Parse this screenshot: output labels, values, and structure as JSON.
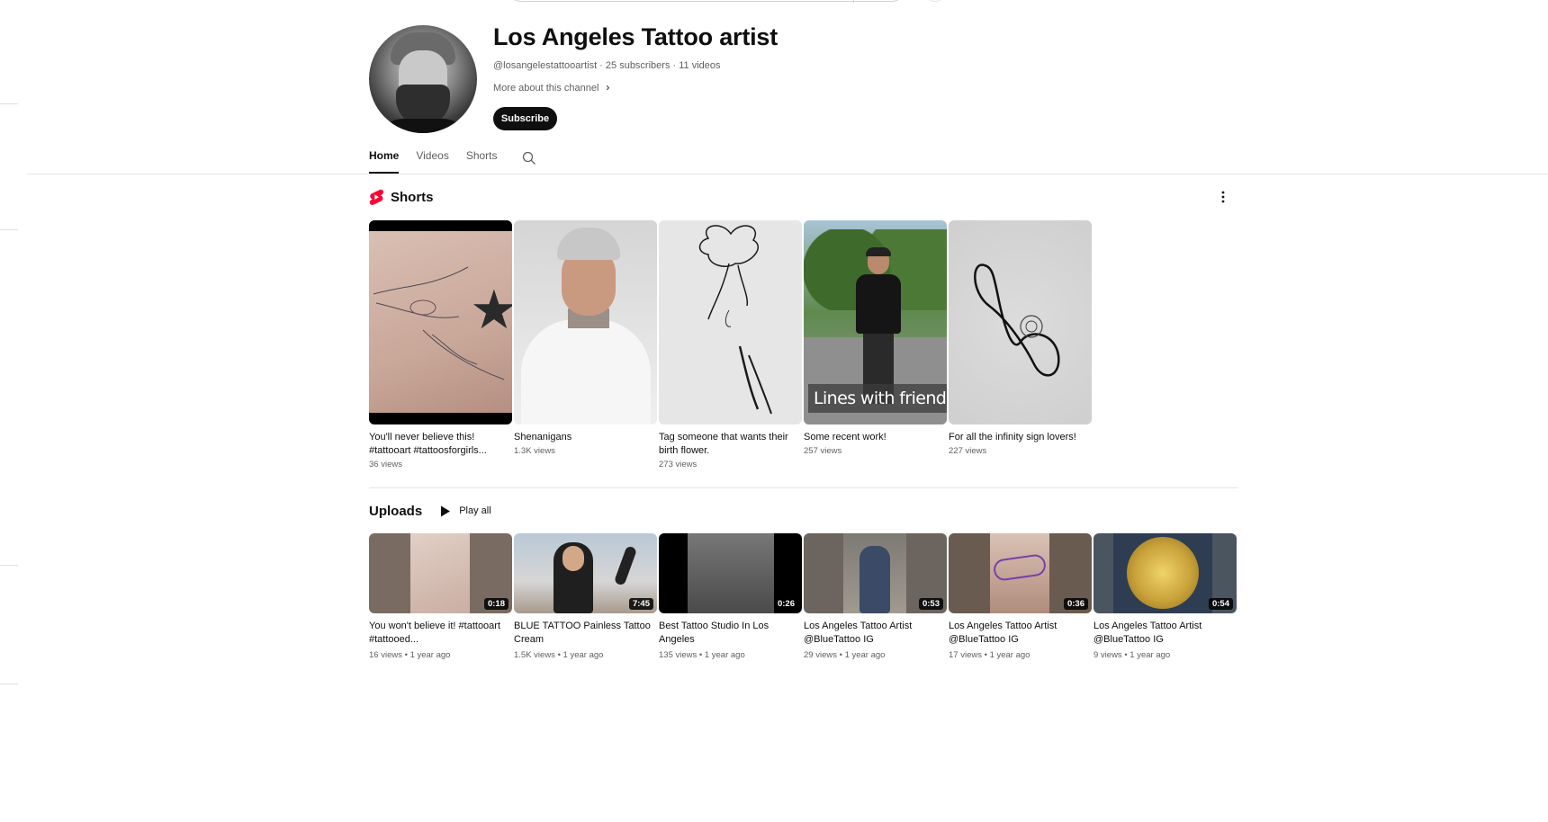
{
  "channel": {
    "title": "Los Angeles Tattoo artist",
    "handle": "@losangelestattooartist",
    "subscribers": "25 subscribers",
    "videos_count": "11 videos",
    "separator": " · ",
    "more_about": "More about this channel",
    "subscribe_label": "Subscribe"
  },
  "tabs": [
    {
      "label": "Home",
      "active": true
    },
    {
      "label": "Videos",
      "active": false
    },
    {
      "label": "Shorts",
      "active": false
    }
  ],
  "shorts": {
    "section_title": "Shorts",
    "items": [
      {
        "title": "You'll never believe this! #tattooart #tattoosforgirls...",
        "views": "36 views"
      },
      {
        "title": "Shenanigans",
        "views": "1.3K views"
      },
      {
        "title": "Tag someone that wants their birth flower.",
        "views": "273 views"
      },
      {
        "title": "Some recent work!",
        "views": "257 views",
        "overlay_text": "Lines with friends!"
      },
      {
        "title": "For all the infinity sign lovers!",
        "views": "227 views"
      }
    ]
  },
  "uploads": {
    "section_title": "Uploads",
    "play_all_label": "Play all",
    "items": [
      {
        "title": "You won't believe it! #tattooart #tattooed...",
        "duration": "0:18",
        "meta": "16 views • 1 year ago"
      },
      {
        "title": "BLUE TATTOO Painless Tattoo Cream",
        "duration": "7:45",
        "meta": "1.5K views • 1 year ago"
      },
      {
        "title": "Best Tattoo Studio In Los Angeles",
        "duration": "0:26",
        "meta": "135 views • 1 year ago"
      },
      {
        "title": "Los Angeles Tattoo Artist @BlueTattoo IG",
        "duration": "0:53",
        "meta": "29 views • 1 year ago"
      },
      {
        "title": "Los Angeles Tattoo Artist @BlueTattoo IG",
        "duration": "0:36",
        "meta": "17 views • 1 year ago"
      },
      {
        "title": "Los Angeles Tattoo Artist @BlueTattoo IG",
        "duration": "0:54",
        "meta": "9 views • 1 year ago"
      }
    ]
  },
  "icons": {
    "shorts_logo": "shorts-logo-icon",
    "kebab": "more-vert-icon",
    "tab_search": "search-icon",
    "play": "play-icon",
    "chevron": "chevron-right-icon"
  },
  "colors": {
    "text_primary": "#0f0f0f",
    "text_secondary": "#606060",
    "shorts_red": "#ff0033",
    "button_bg": "#0f0f0f"
  }
}
